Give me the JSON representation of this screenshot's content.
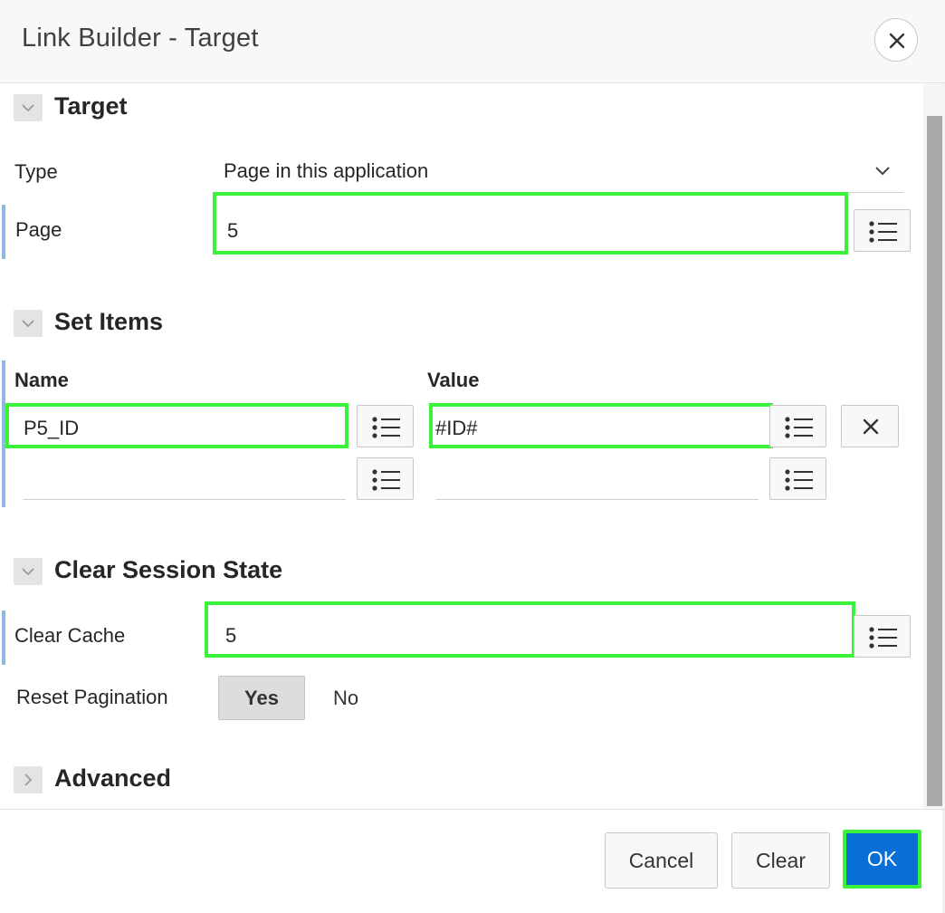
{
  "dialog": {
    "title": "Link Builder - Target"
  },
  "target_section": {
    "title": "Target",
    "type_label": "Type",
    "type_value": "Page in this application",
    "page_label": "Page",
    "page_value": "5"
  },
  "set_items_section": {
    "title": "Set Items",
    "name_header": "Name",
    "value_header": "Value",
    "rows": [
      {
        "name": "P5_ID",
        "value": "#ID#"
      },
      {
        "name": "",
        "value": ""
      }
    ]
  },
  "clear_session_section": {
    "title": "Clear Session State",
    "clear_cache_label": "Clear Cache",
    "clear_cache_value": "5",
    "reset_pagination_label": "Reset Pagination",
    "reset_pagination_options": [
      "Yes",
      "No"
    ],
    "reset_pagination_selected": "Yes"
  },
  "advanced_section": {
    "title": "Advanced",
    "expanded": false
  },
  "footer": {
    "cancel_label": "Cancel",
    "clear_label": "Clear",
    "ok_label": "OK"
  },
  "colors": {
    "highlight": "#3af23a",
    "primary_button": "#0a6ed7",
    "required_indicator": "#91b8e5"
  }
}
